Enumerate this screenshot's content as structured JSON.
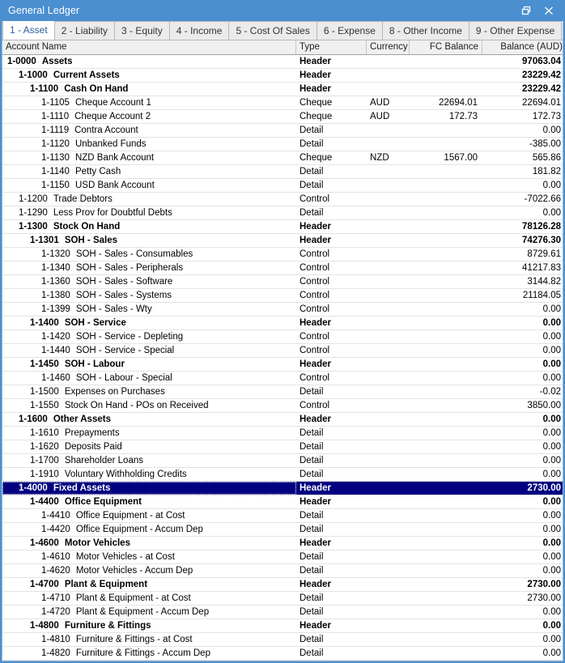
{
  "window": {
    "title": "General Ledger",
    "buttons": [
      {
        "name": "restore-button",
        "label": "restore-icon"
      },
      {
        "name": "close-button",
        "label": "close-icon"
      }
    ]
  },
  "tabs": [
    {
      "label": "1 - Asset",
      "active": true
    },
    {
      "label": "2 - Liability",
      "active": false
    },
    {
      "label": "3 - Equity",
      "active": false
    },
    {
      "label": "4 - Income",
      "active": false
    },
    {
      "label": "5 - Cost Of Sales",
      "active": false
    },
    {
      "label": "6 - Expense",
      "active": false
    },
    {
      "label": "8 - Other Income",
      "active": false
    },
    {
      "label": "9 - Other Expense",
      "active": false
    }
  ],
  "grid": {
    "columns": [
      {
        "key": "name",
        "label": "Account Name",
        "align": "left"
      },
      {
        "key": "type",
        "label": "Type",
        "align": "left"
      },
      {
        "key": "currency",
        "label": "Currency",
        "align": "left"
      },
      {
        "key": "fc_balance",
        "label": "FC Balance",
        "align": "right"
      },
      {
        "key": "balance",
        "label": "Balance (AUD)",
        "align": "right"
      }
    ],
    "rows": [
      {
        "code": "1-0000",
        "name": "Assets",
        "type": "Header",
        "currency": "",
        "fc_balance": "",
        "balance": "97063.04",
        "level": 0,
        "bold": true,
        "selected": false
      },
      {
        "code": "1-1000",
        "name": "Current Assets",
        "type": "Header",
        "currency": "",
        "fc_balance": "",
        "balance": "23229.42",
        "level": 1,
        "bold": true,
        "selected": false
      },
      {
        "code": "1-1100",
        "name": "Cash On Hand",
        "type": "Header",
        "currency": "",
        "fc_balance": "",
        "balance": "23229.42",
        "level": 2,
        "bold": true,
        "selected": false
      },
      {
        "code": "1-1105",
        "name": "Cheque Account 1",
        "type": "Cheque",
        "currency": "AUD",
        "fc_balance": "22694.01",
        "balance": "22694.01",
        "level": 3,
        "bold": false,
        "selected": false
      },
      {
        "code": "1-1110",
        "name": "Cheque Account 2",
        "type": "Cheque",
        "currency": "AUD",
        "fc_balance": "172.73",
        "balance": "172.73",
        "level": 3,
        "bold": false,
        "selected": false
      },
      {
        "code": "1-1119",
        "name": "Contra Account",
        "type": "Detail",
        "currency": "",
        "fc_balance": "",
        "balance": "0.00",
        "level": 3,
        "bold": false,
        "selected": false
      },
      {
        "code": "1-1120",
        "name": "Unbanked Funds",
        "type": "Detail",
        "currency": "",
        "fc_balance": "",
        "balance": "-385.00",
        "level": 3,
        "bold": false,
        "selected": false
      },
      {
        "code": "1-1130",
        "name": "NZD Bank Account",
        "type": "Cheque",
        "currency": "NZD",
        "fc_balance": "1567.00",
        "balance": "565.86",
        "level": 3,
        "bold": false,
        "selected": false
      },
      {
        "code": "1-1140",
        "name": "Petty Cash",
        "type": "Detail",
        "currency": "",
        "fc_balance": "",
        "balance": "181.82",
        "level": 3,
        "bold": false,
        "selected": false
      },
      {
        "code": "1-1150",
        "name": "USD Bank Account",
        "type": "Detail",
        "currency": "",
        "fc_balance": "",
        "balance": "0.00",
        "level": 3,
        "bold": false,
        "selected": false
      },
      {
        "code": "1-1200",
        "name": "Trade Debtors",
        "type": "Control",
        "currency": "",
        "fc_balance": "",
        "balance": "-7022.66",
        "level": 1,
        "bold": false,
        "selected": false
      },
      {
        "code": "1-1290",
        "name": "Less Prov for Doubtful Debts",
        "type": "Detail",
        "currency": "",
        "fc_balance": "",
        "balance": "0.00",
        "level": 1,
        "bold": false,
        "selected": false
      },
      {
        "code": "1-1300",
        "name": "Stock On Hand",
        "type": "Header",
        "currency": "",
        "fc_balance": "",
        "balance": "78126.28",
        "level": 1,
        "bold": true,
        "selected": false
      },
      {
        "code": "1-1301",
        "name": "SOH - Sales",
        "type": "Header",
        "currency": "",
        "fc_balance": "",
        "balance": "74276.30",
        "level": 2,
        "bold": true,
        "selected": false
      },
      {
        "code": "1-1320",
        "name": "SOH - Sales - Consumables",
        "type": "Control",
        "currency": "",
        "fc_balance": "",
        "balance": "8729.61",
        "level": 3,
        "bold": false,
        "selected": false
      },
      {
        "code": "1-1340",
        "name": "SOH - Sales - Peripherals",
        "type": "Control",
        "currency": "",
        "fc_balance": "",
        "balance": "41217.83",
        "level": 3,
        "bold": false,
        "selected": false
      },
      {
        "code": "1-1360",
        "name": "SOH - Sales - Software",
        "type": "Control",
        "currency": "",
        "fc_balance": "",
        "balance": "3144.82",
        "level": 3,
        "bold": false,
        "selected": false
      },
      {
        "code": "1-1380",
        "name": "SOH - Sales - Systems",
        "type": "Control",
        "currency": "",
        "fc_balance": "",
        "balance": "21184.05",
        "level": 3,
        "bold": false,
        "selected": false
      },
      {
        "code": "1-1399",
        "name": "SOH - Sales - Wty",
        "type": "Control",
        "currency": "",
        "fc_balance": "",
        "balance": "0.00",
        "level": 3,
        "bold": false,
        "selected": false
      },
      {
        "code": "1-1400",
        "name": "SOH - Service",
        "type": "Header",
        "currency": "",
        "fc_balance": "",
        "balance": "0.00",
        "level": 2,
        "bold": true,
        "selected": false
      },
      {
        "code": "1-1420",
        "name": "SOH - Service - Depleting",
        "type": "Control",
        "currency": "",
        "fc_balance": "",
        "balance": "0.00",
        "level": 3,
        "bold": false,
        "selected": false
      },
      {
        "code": "1-1440",
        "name": "SOH - Service - Special",
        "type": "Control",
        "currency": "",
        "fc_balance": "",
        "balance": "0.00",
        "level": 3,
        "bold": false,
        "selected": false
      },
      {
        "code": "1-1450",
        "name": "SOH - Labour",
        "type": "Header",
        "currency": "",
        "fc_balance": "",
        "balance": "0.00",
        "level": 2,
        "bold": true,
        "selected": false
      },
      {
        "code": "1-1460",
        "name": "SOH - Labour - Special",
        "type": "Control",
        "currency": "",
        "fc_balance": "",
        "balance": "0.00",
        "level": 3,
        "bold": false,
        "selected": false
      },
      {
        "code": "1-1500",
        "name": "Expenses on Purchases",
        "type": "Detail",
        "currency": "",
        "fc_balance": "",
        "balance": "-0.02",
        "level": 2,
        "bold": false,
        "selected": false
      },
      {
        "code": "1-1550",
        "name": "Stock On Hand - POs on Received",
        "type": "Control",
        "currency": "",
        "fc_balance": "",
        "balance": "3850.00",
        "level": 2,
        "bold": false,
        "selected": false
      },
      {
        "code": "1-1600",
        "name": "Other Assets",
        "type": "Header",
        "currency": "",
        "fc_balance": "",
        "balance": "0.00",
        "level": 1,
        "bold": true,
        "selected": false
      },
      {
        "code": "1-1610",
        "name": "Prepayments",
        "type": "Detail",
        "currency": "",
        "fc_balance": "",
        "balance": "0.00",
        "level": 2,
        "bold": false,
        "selected": false
      },
      {
        "code": "1-1620",
        "name": "Deposits Paid",
        "type": "Detail",
        "currency": "",
        "fc_balance": "",
        "balance": "0.00",
        "level": 2,
        "bold": false,
        "selected": false
      },
      {
        "code": "1-1700",
        "name": "Shareholder Loans",
        "type": "Detail",
        "currency": "",
        "fc_balance": "",
        "balance": "0.00",
        "level": 2,
        "bold": false,
        "selected": false
      },
      {
        "code": "1-1910",
        "name": "Voluntary Withholding Credits",
        "type": "Detail",
        "currency": "",
        "fc_balance": "",
        "balance": "0.00",
        "level": 2,
        "bold": false,
        "selected": false
      },
      {
        "code": "1-4000",
        "name": "Fixed Assets",
        "type": "Header",
        "currency": "",
        "fc_balance": "",
        "balance": "2730.00",
        "level": 1,
        "bold": true,
        "selected": true
      },
      {
        "code": "1-4400",
        "name": "Office Equipment",
        "type": "Header",
        "currency": "",
        "fc_balance": "",
        "balance": "0.00",
        "level": 2,
        "bold": true,
        "selected": false
      },
      {
        "code": "1-4410",
        "name": "Office Equipment - at Cost",
        "type": "Detail",
        "currency": "",
        "fc_balance": "",
        "balance": "0.00",
        "level": 3,
        "bold": false,
        "selected": false
      },
      {
        "code": "1-4420",
        "name": "Office Equipment - Accum Dep",
        "type": "Detail",
        "currency": "",
        "fc_balance": "",
        "balance": "0.00",
        "level": 3,
        "bold": false,
        "selected": false
      },
      {
        "code": "1-4600",
        "name": "Motor Vehicles",
        "type": "Header",
        "currency": "",
        "fc_balance": "",
        "balance": "0.00",
        "level": 2,
        "bold": true,
        "selected": false
      },
      {
        "code": "1-4610",
        "name": "Motor Vehicles - at Cost",
        "type": "Detail",
        "currency": "",
        "fc_balance": "",
        "balance": "0.00",
        "level": 3,
        "bold": false,
        "selected": false
      },
      {
        "code": "1-4620",
        "name": "Motor Vehicles - Accum Dep",
        "type": "Detail",
        "currency": "",
        "fc_balance": "",
        "balance": "0.00",
        "level": 3,
        "bold": false,
        "selected": false
      },
      {
        "code": "1-4700",
        "name": "Plant & Equipment",
        "type": "Header",
        "currency": "",
        "fc_balance": "",
        "balance": "2730.00",
        "level": 2,
        "bold": true,
        "selected": false
      },
      {
        "code": "1-4710",
        "name": "Plant & Equipment - at Cost",
        "type": "Detail",
        "currency": "",
        "fc_balance": "",
        "balance": "2730.00",
        "level": 3,
        "bold": false,
        "selected": false
      },
      {
        "code": "1-4720",
        "name": "Plant & Equipment - Accum Dep",
        "type": "Detail",
        "currency": "",
        "fc_balance": "",
        "balance": "0.00",
        "level": 3,
        "bold": false,
        "selected": false
      },
      {
        "code": "1-4800",
        "name": "Furniture & Fittings",
        "type": "Header",
        "currency": "",
        "fc_balance": "",
        "balance": "0.00",
        "level": 2,
        "bold": true,
        "selected": false
      },
      {
        "code": "1-4810",
        "name": "Furniture & Fittings - at Cost",
        "type": "Detail",
        "currency": "",
        "fc_balance": "",
        "balance": "0.00",
        "level": 3,
        "bold": false,
        "selected": false
      },
      {
        "code": "1-4820",
        "name": "Furniture & Fittings - Accum Dep",
        "type": "Detail",
        "currency": "",
        "fc_balance": "",
        "balance": "0.00",
        "level": 3,
        "bold": false,
        "selected": false
      }
    ]
  },
  "colors": {
    "title_bar": "#4a8fd0",
    "selection": "#000080",
    "active_tab_text": "#2a6099"
  }
}
